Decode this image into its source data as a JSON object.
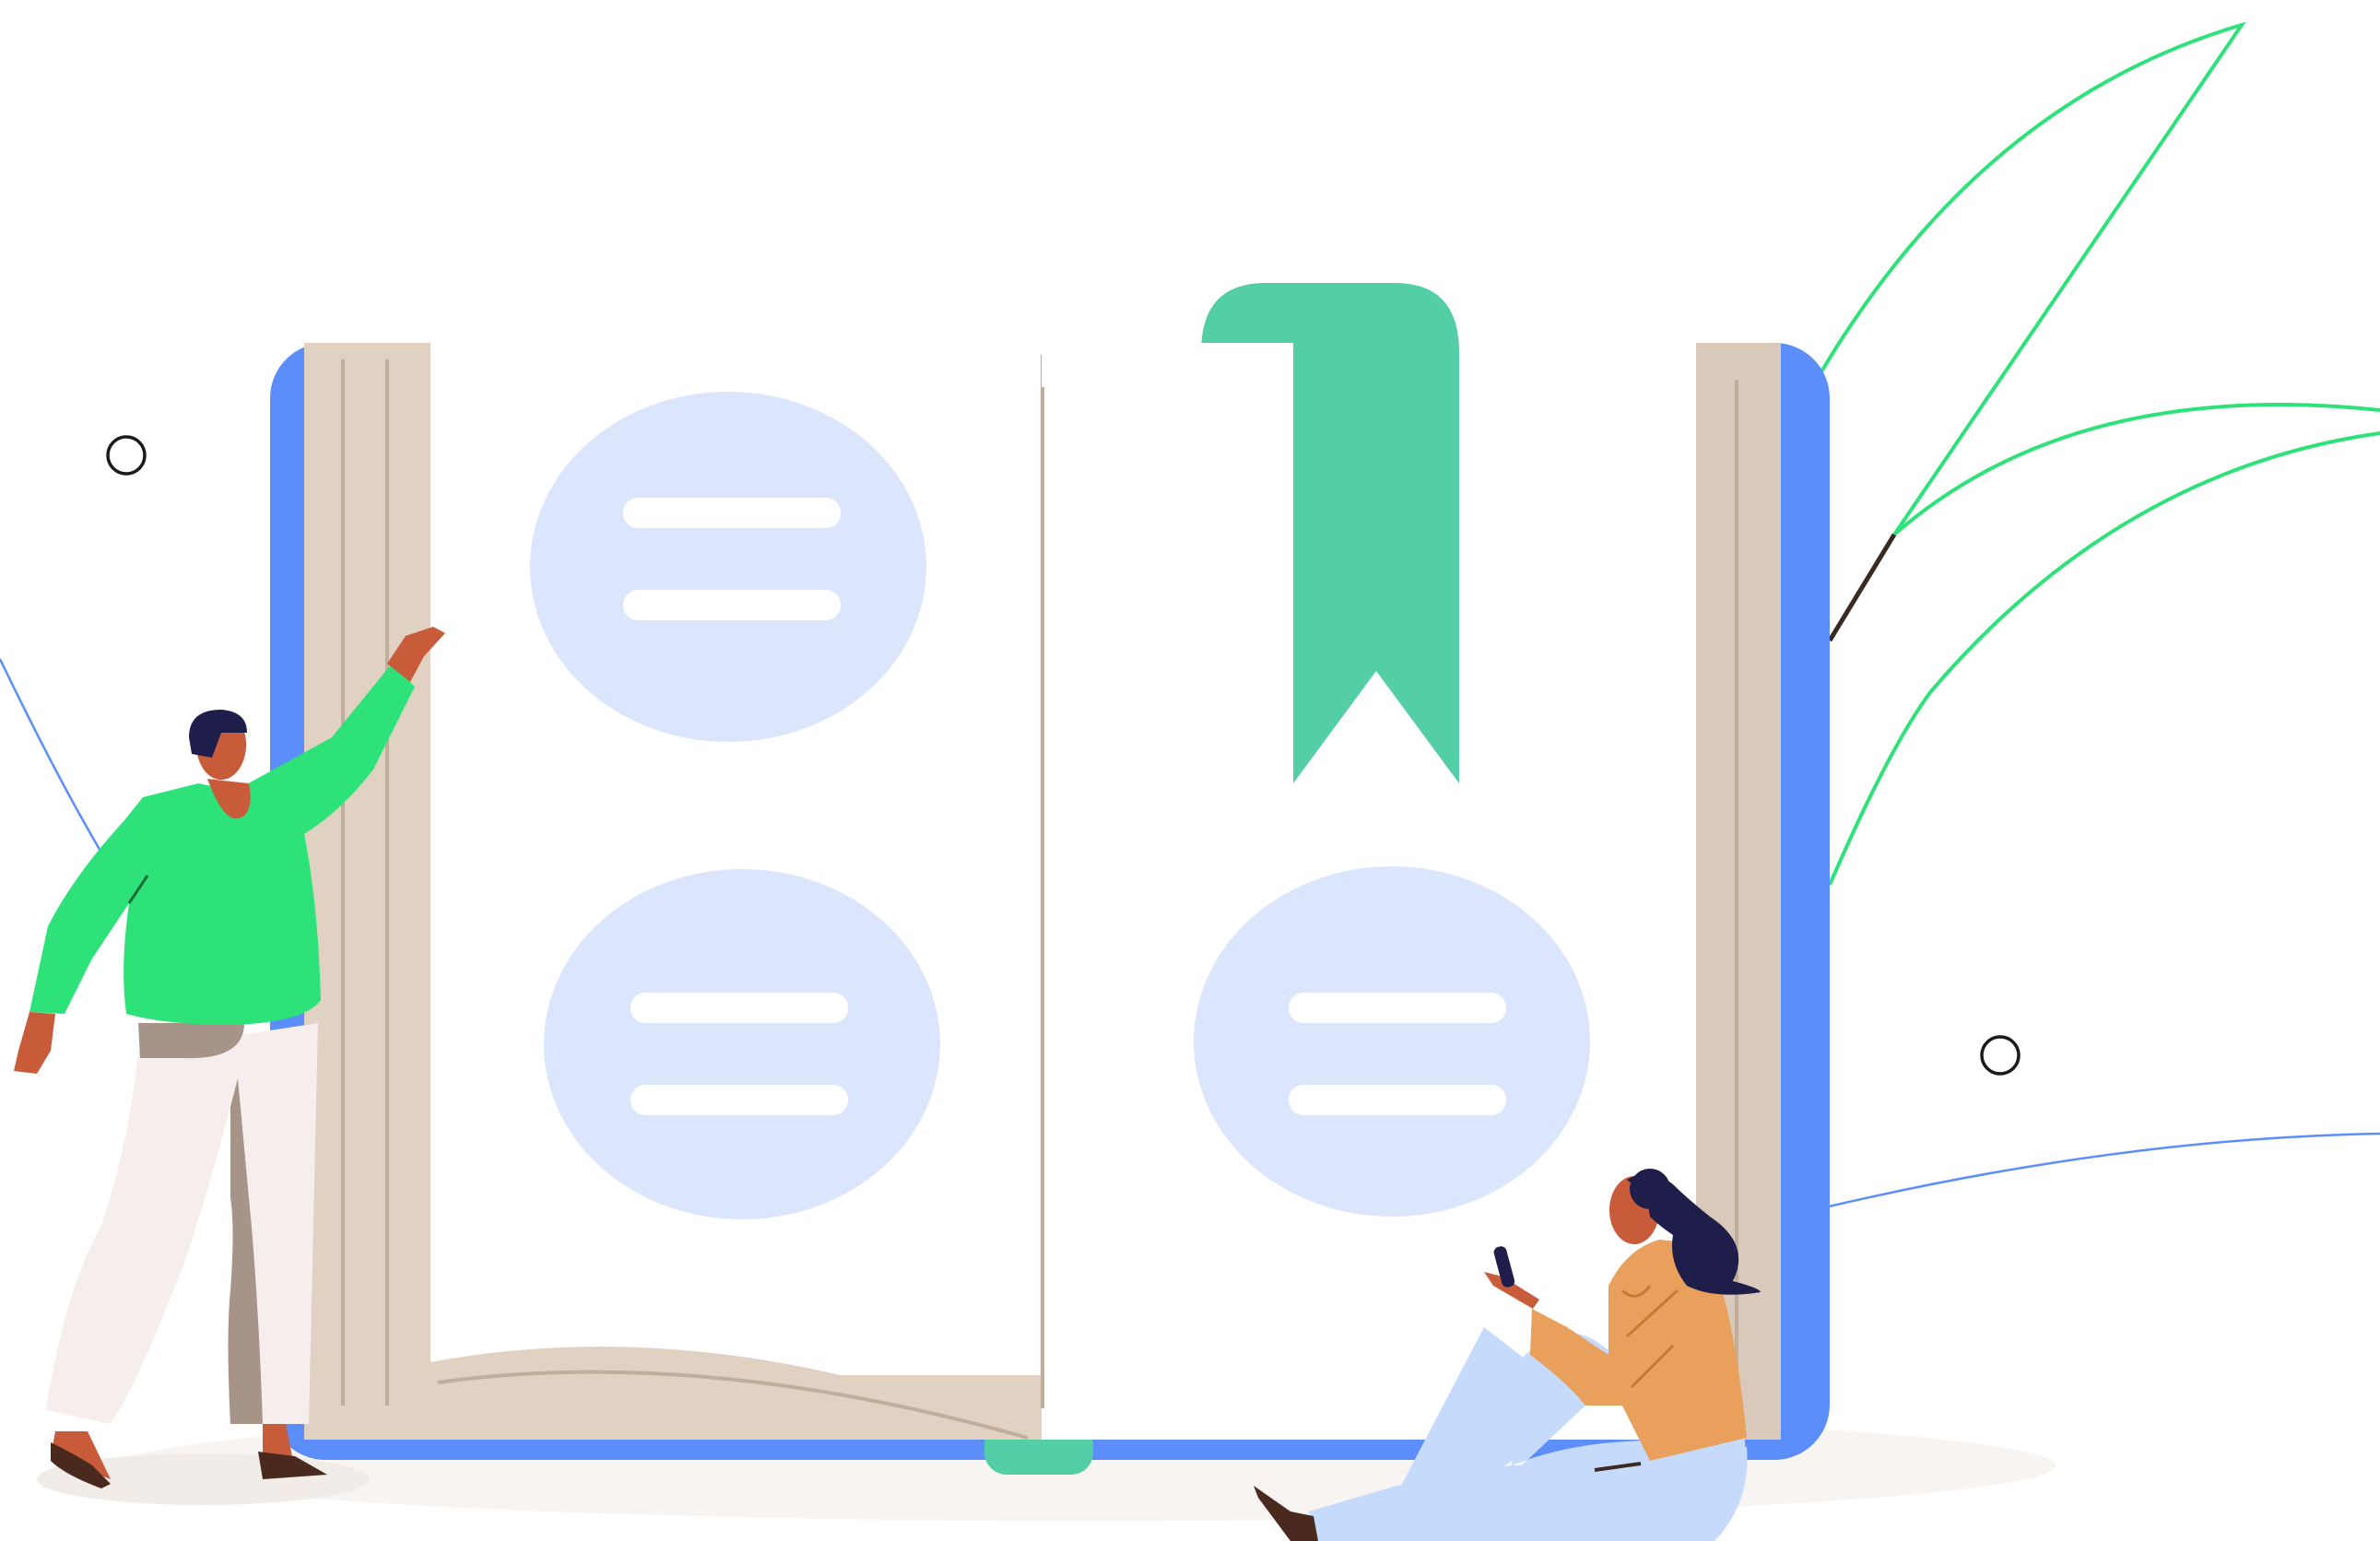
{
  "scene": {
    "description_free": true,
    "colors": {
      "background": "#ffffff",
      "book_cover": "#5B8DFB",
      "page_edge": "#E0D1C2",
      "page_line": "#BFAE9C",
      "bookmark": "#54CEA6",
      "bubble": "#DBE6FD",
      "leaf_outline": "#2EE27A",
      "stem": "#3A2A20",
      "shadow": "#F7F4F1",
      "man_shirt": "#2EE27A",
      "man_skin": "#C75B3A",
      "man_pants": "#F5EEEC",
      "man_pants_shade": "#A79488",
      "hair": "#1F1D4A",
      "woman_top": "#E8A05C",
      "woman_pants": "#C6DBFB",
      "shoe": "#4A2A1E",
      "thin_curve": "#5B8DFB",
      "circle_marker": "#1A1A1A"
    },
    "icons": [
      "open-book-icon",
      "bookmark-icon",
      "chat-bubble-icon",
      "leaf-icon",
      "person-icon"
    ]
  }
}
